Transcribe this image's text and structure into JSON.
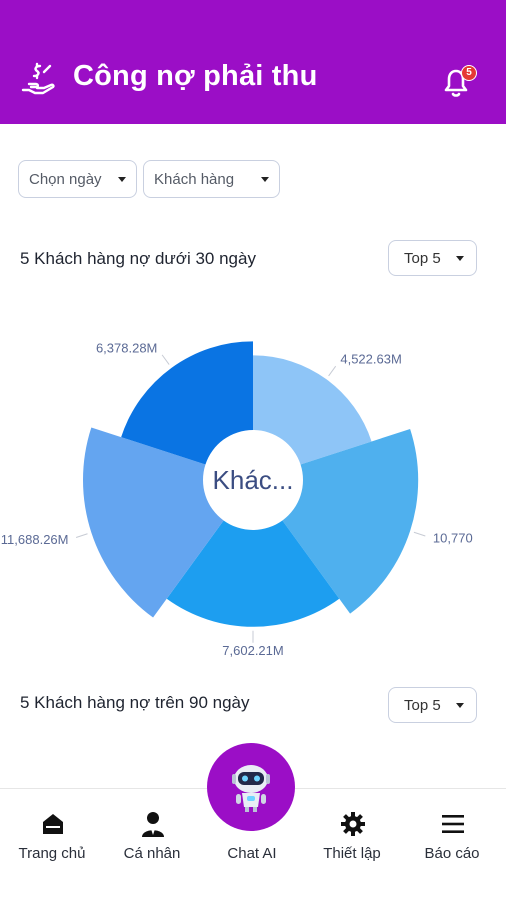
{
  "header": {
    "title": "Công nợ phải thu",
    "notification_count": "5"
  },
  "filters": {
    "date": "Chọn ngày",
    "customer": "Khách hàng"
  },
  "section1": {
    "title": "5 Khách hàng nợ dưới 30 ngày",
    "top_select": "Top 5"
  },
  "section2": {
    "title": "5 Khách hàng nợ trên 90 ngày",
    "top_select": "Top 5"
  },
  "chart_data": {
    "type": "pie",
    "subtype": "nightingale-rose",
    "center_label": "Khác...",
    "slices": [
      {
        "label": "4,522.63M",
        "value": 4522.63,
        "color": "#8ec5f7"
      },
      {
        "label": "10,770",
        "value": 10770,
        "color": "#4fb0ee"
      },
      {
        "label": "7,602.21M",
        "value": 7602.21,
        "color": "#1d9ef0"
      },
      {
        "label": "11,688.26M",
        "value": 11688.26,
        "color": "#64a5f0"
      },
      {
        "label": "6,378.28M",
        "value": 6378.28,
        "color": "#0a74e3"
      }
    ]
  },
  "nav": {
    "home": "Trang chủ",
    "profile": "Cá nhân",
    "chat": "Chat AI",
    "settings": "Thiết lập",
    "report": "Báo cáo"
  }
}
